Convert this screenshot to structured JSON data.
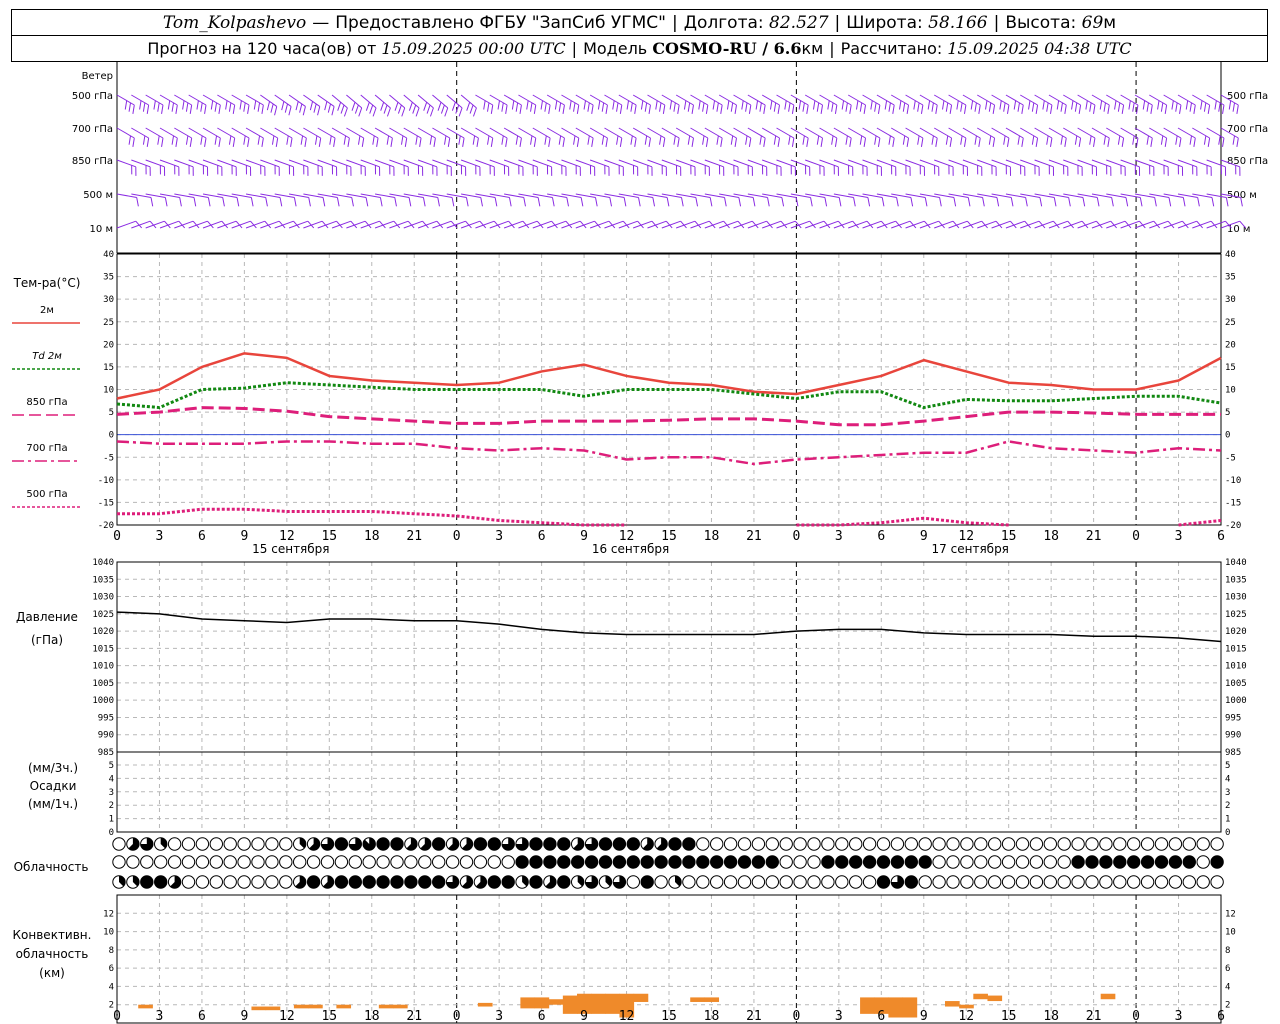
{
  "header": {
    "station": "Tom_Kolpashevo",
    "dash": "—",
    "provider": "Предоставлено ФГБУ \"ЗапСиб УГМС\"",
    "lon_label": "Долгота:",
    "lon": "82.527",
    "lat_label": "Широта:",
    "lat": "58.166",
    "alt_label": "Высота:",
    "alt": "69",
    "alt_unit": "м",
    "forecast_label": "Прогноз на 120 часа(ов) от",
    "forecast_time": "15.09.2025 00:00 UTC",
    "model_label": "Модель",
    "model": "COSMO-RU / 6.6",
    "model_unit": "км",
    "computed_label": "Рассчитано:",
    "computed_time": "15.09.2025 04:38 UTC"
  },
  "labels": {
    "wind_title": "Ветер",
    "wind_levels": [
      "500 гПа",
      "700 гПа",
      "850 гПа",
      "500 м",
      "10  м"
    ],
    "temp_title": "Тем-ра(°C)",
    "temp_legend": [
      {
        "label": "2м",
        "color": "#e8453c",
        "style": "solid"
      },
      {
        "label": "Td  2м",
        "color": "#118811",
        "style": "dotted"
      },
      {
        "label": "850 гПа",
        "color": "#dd1e7a",
        "style": "dashed"
      },
      {
        "label": "700 гПа",
        "color": "#dd1e7a",
        "style": "dashdot"
      },
      {
        "label": "500 гПа",
        "color": "#dd1e7a",
        "style": "dotted"
      }
    ],
    "pressure_title": "Давление",
    "pressure_unit": "(гПа)",
    "precip_unit_top": "(мм/3ч.)",
    "precip_title": "Осадки",
    "precip_unit_bottom": "(мм/1ч.)",
    "cloud_title": "Облачность",
    "conv_title_1": "Конвективн.",
    "conv_title_2": "облачность",
    "conv_unit": "(км)"
  },
  "time_axis": {
    "hour_ticks": [
      "0",
      "3",
      "6",
      "9",
      "12",
      "15",
      "18",
      "21",
      "0",
      "3",
      "6",
      "9",
      "12",
      "15",
      "18",
      "21",
      "0",
      "3",
      "6",
      "9",
      "12",
      "15",
      "18",
      "21",
      "0",
      "3",
      "6"
    ],
    "dates": [
      "15 сентября",
      "16 сентября",
      "17 сентября"
    ]
  },
  "colors": {
    "wind": "#8a2be2",
    "t2m": "#e8453c",
    "td2m": "#118811",
    "upper": "#dd1e7a",
    "pressure": "#000000",
    "convective": "#ef8a2a"
  },
  "chart_data": [
    {
      "type": "line",
      "title": "Тем-ра(°C)",
      "x_hours": [
        0,
        3,
        6,
        9,
        12,
        15,
        18,
        21,
        24,
        27,
        30,
        33,
        36,
        39,
        42,
        45,
        48,
        51,
        54,
        57,
        60,
        63,
        66,
        69,
        72,
        75,
        78
      ],
      "ylim": [
        -20,
        40
      ],
      "yticks": [
        40,
        35,
        30,
        25,
        20,
        15,
        10,
        5,
        0,
        -5,
        -10,
        -15,
        -20
      ],
      "series": [
        {
          "name": "2м",
          "values": [
            8,
            10,
            15,
            18,
            17,
            13,
            12,
            11.5,
            11,
            11.5,
            14,
            15.5,
            13,
            11.5,
            11,
            9.5,
            9,
            11,
            13,
            16.5,
            14,
            11.5,
            11,
            10,
            10,
            12,
            17
          ]
        },
        {
          "name": "Td  2м",
          "values": [
            6.8,
            6,
            10,
            10.3,
            11.5,
            11,
            10.5,
            10,
            10,
            10,
            10,
            8.5,
            10,
            10,
            10,
            9,
            8,
            9.5,
            9.5,
            6,
            7.8,
            7.5,
            7.5,
            8,
            8.5,
            8.5,
            7
          ]
        },
        {
          "name": "850 гПа",
          "values": [
            4.5,
            5,
            6,
            5.8,
            5.2,
            4,
            3.5,
            3,
            2.5,
            2.5,
            3,
            3,
            3,
            3.2,
            3.5,
            3.5,
            3,
            2.2,
            2.2,
            3,
            4,
            5,
            5,
            4.8,
            4.5,
            4.5,
            4.5
          ]
        },
        {
          "name": "700 гПа",
          "values": [
            -1.5,
            -2,
            -2,
            -2,
            -1.5,
            -1.5,
            -2,
            -2,
            -3,
            -3.5,
            -3,
            -3.5,
            -5.5,
            -5,
            -5,
            -6.5,
            -5.5,
            -5,
            -4.5,
            -4,
            -4,
            -1.5,
            -3,
            -3.5,
            -4,
            -3,
            -3.5
          ]
        },
        {
          "name": "500 гПа",
          "values": [
            -17.5,
            -17.5,
            -16.5,
            -16.5,
            -17,
            -17,
            -17,
            -17.5,
            -18,
            -19,
            -19.5,
            -20,
            -20,
            null,
            null,
            null,
            -20,
            -20,
            -19.5,
            -18.5,
            -19.5,
            -20,
            null,
            null,
            null,
            -20,
            -19
          ]
        }
      ]
    },
    {
      "type": "line",
      "title": "Давление",
      "ylabel": "(гПа)",
      "x_hours": [
        0,
        3,
        6,
        9,
        12,
        15,
        18,
        21,
        24,
        27,
        30,
        33,
        36,
        39,
        42,
        45,
        48,
        51,
        54,
        57,
        60,
        63,
        66,
        69,
        72,
        75,
        78
      ],
      "ylim": [
        985,
        1040
      ],
      "yticks": [
        1040,
        1035,
        1030,
        1025,
        1020,
        1015,
        1010,
        1005,
        1000,
        995,
        990,
        985
      ],
      "series": [
        {
          "name": "",
          "values": [
            1025.5,
            1025,
            1023.5,
            1023,
            1022.5,
            1023.5,
            1023.5,
            1023,
            1023,
            1022,
            1020.5,
            1019.5,
            1019,
            1019,
            1019,
            1019,
            1020,
            1020.5,
            1020.5,
            1019.5,
            1019,
            1019,
            1019,
            1018.5,
            1018.5,
            1018,
            1017
          ]
        }
      ]
    },
    {
      "type": "bar",
      "title": "Осадки",
      "ylabel_top": "(мм/3ч.)",
      "ylabel_bottom": "(мм/1ч.)",
      "ylim": [
        0,
        6
      ],
      "yticks": [
        6,
        5,
        4,
        3,
        2,
        1,
        0
      ],
      "values": []
    },
    {
      "type": "bar",
      "title": "Конвективн. облачность",
      "ylabel": "(км)",
      "ylim": [
        0,
        14
      ],
      "yticks": [
        12,
        10,
        8,
        6,
        4,
        2
      ],
      "bars": [
        {
          "x": 2,
          "lo": 1.6,
          "hi": 2.0
        },
        {
          "x": 10,
          "lo": 1.4,
          "hi": 1.8
        },
        {
          "x": 11,
          "lo": 1.4,
          "hi": 1.8
        },
        {
          "x": 13,
          "lo": 1.6,
          "hi": 2.0
        },
        {
          "x": 14,
          "lo": 1.6,
          "hi": 2.0
        },
        {
          "x": 16,
          "lo": 1.6,
          "hi": 2.0
        },
        {
          "x": 19,
          "lo": 1.6,
          "hi": 2.0
        },
        {
          "x": 20,
          "lo": 1.6,
          "hi": 2.0
        },
        {
          "x": 26,
          "lo": 1.8,
          "hi": 2.2
        },
        {
          "x": 29,
          "lo": 1.6,
          "hi": 2.8
        },
        {
          "x": 30,
          "lo": 1.6,
          "hi": 2.8
        },
        {
          "x": 31,
          "lo": 2.0,
          "hi": 2.6
        },
        {
          "x": 32,
          "lo": 1.0,
          "hi": 3.0
        },
        {
          "x": 33,
          "lo": 1.0,
          "hi": 3.2
        },
        {
          "x": 34,
          "lo": 1.0,
          "hi": 3.2
        },
        {
          "x": 35,
          "lo": 1.0,
          "hi": 3.2
        },
        {
          "x": 36,
          "lo": 0.6,
          "hi": 3.2
        },
        {
          "x": 37,
          "lo": 2.3,
          "hi": 3.2
        },
        {
          "x": 41,
          "lo": 2.3,
          "hi": 2.8
        },
        {
          "x": 42,
          "lo": 2.3,
          "hi": 2.8
        },
        {
          "x": 53,
          "lo": 1.0,
          "hi": 2.8
        },
        {
          "x": 54,
          "lo": 1.0,
          "hi": 2.8
        },
        {
          "x": 55,
          "lo": 0.6,
          "hi": 2.8
        },
        {
          "x": 56,
          "lo": 0.6,
          "hi": 2.8
        },
        {
          "x": 59,
          "lo": 1.8,
          "hi": 2.4
        },
        {
          "x": 60,
          "lo": 1.6,
          "hi": 2.0
        },
        {
          "x": 61,
          "lo": 2.6,
          "hi": 3.2
        },
        {
          "x": 62,
          "lo": 2.4,
          "hi": 3.0
        },
        {
          "x": 70,
          "lo": 2.6,
          "hi": 3.2
        }
      ]
    }
  ],
  "wind": {
    "hours_step": 1,
    "levels": [
      {
        "name": "500 гПа",
        "dirs": [
          300,
          300,
          300,
          300,
          300,
          300,
          300,
          300,
          300,
          300,
          305,
          305,
          305,
          305,
          305,
          310,
          310,
          310,
          310,
          310,
          310,
          310,
          310,
          310,
          310,
          300,
          300,
          300,
          300,
          300,
          300,
          300,
          300,
          300,
          300,
          300,
          300,
          300,
          300,
          300,
          300,
          300,
          300,
          300,
          300,
          300,
          300,
          300,
          300,
          300,
          300,
          300,
          300,
          300,
          300,
          300,
          300,
          300,
          300,
          300,
          300,
          300,
          300,
          300,
          300,
          300,
          300,
          300,
          300,
          300,
          300,
          300,
          300,
          300,
          300,
          300,
          300,
          300
        ],
        "speed": 25
      },
      {
        "name": "700 гПа",
        "dirs": [
          300,
          300,
          300,
          300,
          300,
          300,
          300,
          300,
          300,
          300,
          300,
          300,
          300,
          300,
          300,
          300,
          300,
          300,
          300,
          300,
          300,
          300,
          300,
          300,
          300,
          300,
          300,
          300,
          300,
          300,
          300,
          300,
          300,
          300,
          300,
          300,
          300,
          300,
          300,
          300,
          300,
          300,
          300,
          300,
          300,
          300,
          300,
          300,
          300,
          300,
          300,
          300,
          300,
          300,
          300,
          300,
          300,
          300,
          300,
          300,
          300,
          300,
          300,
          300,
          300,
          300,
          300,
          300,
          300,
          300,
          300,
          300,
          300,
          300,
          300,
          300,
          300,
          300
        ],
        "speed": 20
      },
      {
        "name": "850 гПа",
        "dirs": [
          290,
          290,
          290,
          290,
          290,
          290,
          290,
          290,
          290,
          290,
          290,
          290,
          290,
          290,
          290,
          290,
          290,
          290,
          290,
          290,
          290,
          290,
          290,
          290,
          290,
          290,
          290,
          290,
          290,
          290,
          290,
          290,
          290,
          290,
          290,
          290,
          290,
          290,
          290,
          290,
          290,
          290,
          290,
          290,
          290,
          290,
          290,
          290,
          290,
          290,
          290,
          290,
          290,
          290,
          290,
          290,
          290,
          290,
          290,
          290,
          290,
          290,
          290,
          290,
          290,
          290,
          290,
          290,
          290,
          290,
          290,
          290,
          290,
          290,
          290,
          290,
          290,
          290
        ],
        "speed": 15
      },
      {
        "name": "500 м",
        "dirs": [
          280,
          280,
          280,
          280,
          280,
          280,
          280,
          280,
          280,
          280,
          280,
          280,
          280,
          280,
          280,
          280,
          280,
          280,
          280,
          280,
          280,
          280,
          280,
          280,
          280,
          280,
          280,
          280,
          280,
          280,
          280,
          280,
          280,
          280,
          280,
          280,
          280,
          280,
          280,
          280,
          280,
          280,
          280,
          280,
          280,
          280,
          280,
          280,
          280,
          280,
          280,
          280,
          280,
          280,
          280,
          280,
          280,
          280,
          280,
          280,
          280,
          280,
          280,
          280,
          280,
          280,
          280,
          280,
          280,
          280,
          280,
          280,
          280,
          280,
          280,
          280,
          280,
          280
        ],
        "speed": 12
      },
      {
        "name": "10  м",
        "dirs": [
          250,
          250,
          250,
          250,
          250,
          250,
          250,
          250,
          250,
          250,
          250,
          250,
          250,
          250,
          250,
          250,
          250,
          250,
          250,
          250,
          250,
          250,
          250,
          250,
          250,
          250,
          250,
          250,
          250,
          250,
          250,
          250,
          250,
          250,
          250,
          250,
          250,
          250,
          250,
          250,
          250,
          250,
          250,
          250,
          250,
          250,
          250,
          250,
          250,
          250,
          250,
          250,
          250,
          250,
          250,
          250,
          250,
          250,
          250,
          250,
          250,
          250,
          250,
          250,
          250,
          250,
          250,
          250,
          250,
          250,
          250,
          250,
          250,
          250,
          250,
          250,
          250,
          250
        ],
        "speed": 5
      }
    ]
  },
  "cloud": {
    "rows": [
      "00000000000000000000000000000000000000000000000000000000000000000000000000000000",
      "00000000000000000000000000000000000000000000000000000000000000000000000000000000",
      "00000000000000000000000000000000000000000000000000000000000000000000000000000000"
    ],
    "hours": [
      0,
      1,
      2,
      3,
      4,
      5,
      6,
      7,
      8,
      9,
      10,
      11,
      12,
      13,
      14,
      15,
      16,
      17,
      18,
      19,
      20,
      21,
      22,
      23,
      24,
      25,
      26,
      27,
      28,
      29,
      30,
      31,
      32,
      33,
      34,
      35,
      36,
      37,
      38,
      39,
      40,
      41,
      42,
      43,
      44,
      45,
      46,
      47,
      48,
      49,
      50,
      51,
      52,
      53,
      54,
      55,
      56,
      57,
      58,
      59,
      60,
      61,
      62,
      63,
      64,
      65,
      66,
      67,
      68,
      69,
      70,
      71,
      72,
      73,
      74,
      75,
      76,
      77,
      78
    ],
    "top": [
      0,
      5,
      6,
      3,
      0,
      0,
      0,
      0,
      0,
      0,
      0,
      0,
      0,
      3,
      5,
      6,
      8,
      6,
      7,
      8,
      8,
      5,
      5,
      8,
      5,
      5,
      8,
      8,
      6,
      6,
      8,
      8,
      8,
      5,
      6,
      8,
      8,
      8,
      5,
      5,
      8,
      8,
      0,
      0,
      0,
      0,
      0,
      0,
      0,
      0,
      0,
      0,
      0,
      0,
      0,
      0,
      0,
      0,
      0,
      0,
      0,
      0,
      0,
      0,
      0,
      0,
      0,
      0,
      0,
      0,
      0,
      0,
      0,
      0,
      0,
      0,
      0,
      0,
      0,
      0,
      8,
      6,
      6,
      8,
      8,
      6,
      6,
      8,
      8,
      8,
      6,
      6,
      8,
      0,
      6,
      0,
      0,
      0,
      0
    ],
    "middle": [
      0,
      0,
      0,
      0,
      0,
      0,
      0,
      0,
      0,
      0,
      0,
      0,
      0,
      0,
      0,
      0,
      0,
      0,
      0,
      0,
      0,
      0,
      0,
      0,
      0,
      0,
      0,
      0,
      0,
      8,
      8,
      8,
      8,
      8,
      8,
      8,
      8,
      8,
      8,
      8,
      8,
      8,
      8,
      8,
      8,
      8,
      8,
      8,
      0,
      0,
      0,
      8,
      8,
      8,
      8,
      8,
      8,
      8,
      8,
      0,
      0,
      0,
      0,
      0,
      0,
      0,
      0,
      0,
      0,
      8,
      8,
      8,
      8,
      8,
      8,
      8,
      8,
      8,
      0,
      8,
      6,
      6,
      0,
      0,
      0,
      0,
      0,
      0
    ],
    "bottom": [
      3,
      3,
      8,
      8,
      5,
      0,
      0,
      0,
      0,
      0,
      0,
      0,
      0,
      5,
      8,
      5,
      8,
      8,
      8,
      8,
      8,
      8,
      8,
      8,
      6,
      5,
      5,
      8,
      8,
      3,
      8,
      5,
      8,
      3,
      6,
      3,
      6,
      0,
      8,
      0,
      3,
      0,
      0,
      0,
      0,
      0,
      0,
      0,
      0,
      0,
      0,
      0,
      0,
      0,
      0,
      8,
      6,
      8,
      0,
      0,
      0,
      0,
      0,
      0,
      0,
      0,
      0,
      0,
      0,
      0,
      0,
      0,
      0,
      0,
      0,
      0,
      0,
      0,
      0,
      0,
      0
    ]
  }
}
